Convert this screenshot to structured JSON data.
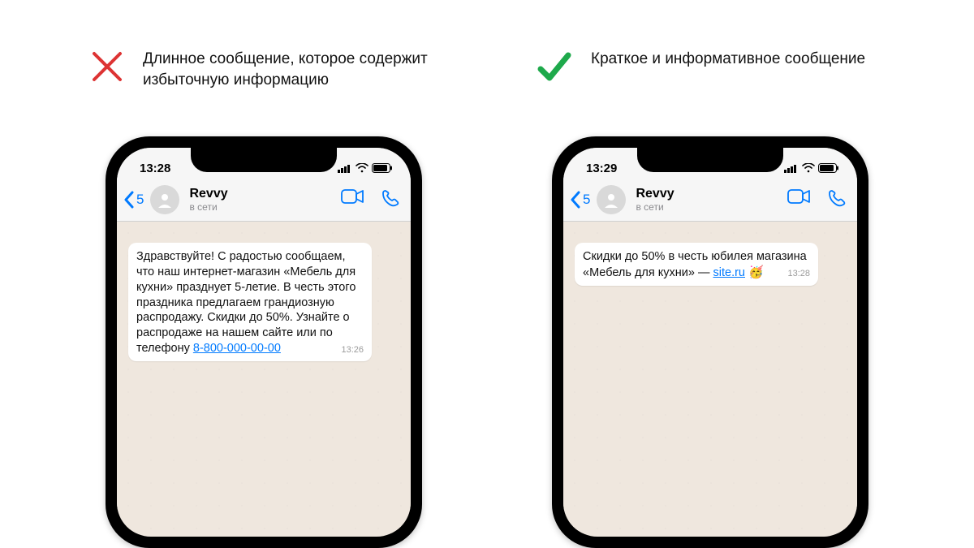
{
  "left": {
    "caption": "Длинное сообщение, которое содержит избыточную информацию",
    "status_time": "13:28",
    "back_count": "5",
    "contact_name": "Revvy",
    "contact_status": "в сети",
    "message": "Здравствуйте! С радостью сообщаем, что наш интернет-магазин «Мебель для кухни» празднует 5-летие. В честь этого праздника предлагаем грандиозную распродажу. Скидки до 50%. Узнайте о распродаже на нашем сайте или по телефону ",
    "message_link": "8-800-000-00-00",
    "message_time": "13:26"
  },
  "right": {
    "caption": "Краткое и информативное сообщение",
    "status_time": "13:29",
    "back_count": "5",
    "contact_name": "Revvy",
    "contact_status": "в сети",
    "message": "Скидки до 50% в честь юбилея магазина «Мебель для кухни» — ",
    "message_link": "site.ru",
    "message_emoji": "🥳",
    "message_time": "13:28"
  },
  "colors": {
    "cross": "#d33",
    "check": "#1ea94b",
    "ios_blue": "#007aff"
  }
}
